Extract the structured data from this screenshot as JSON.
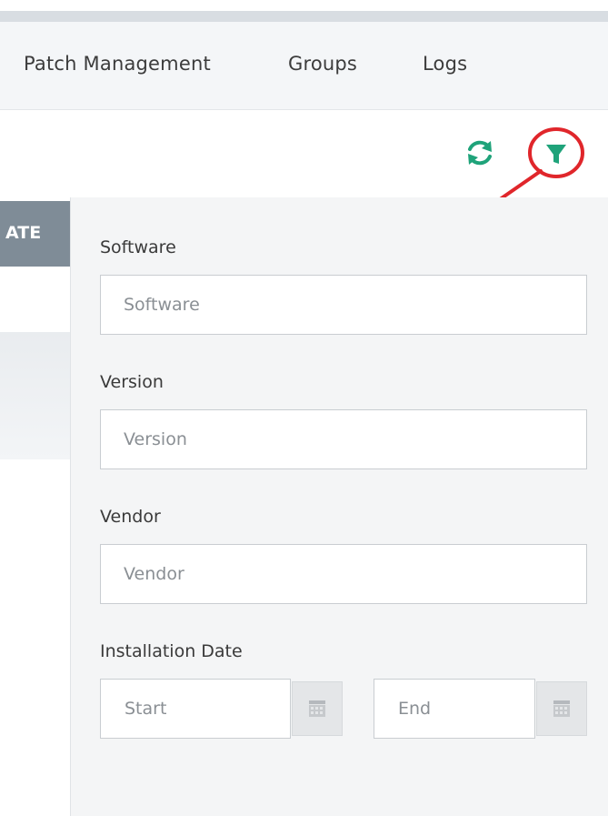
{
  "nav": {
    "items": [
      {
        "label": "Patch Management"
      },
      {
        "label": "Groups"
      },
      {
        "label": "Logs"
      }
    ]
  },
  "toolbar": {
    "refresh_icon": "refresh-icon",
    "filter_icon": "filter-icon",
    "accent_color": "#1fa37a",
    "annotation_color": "#e0262b"
  },
  "left_column": {
    "header_text": "ATE"
  },
  "filter": {
    "software": {
      "label": "Software",
      "placeholder": "Software",
      "value": ""
    },
    "version": {
      "label": "Version",
      "placeholder": "Version",
      "value": ""
    },
    "vendor": {
      "label": "Vendor",
      "placeholder": "Vendor",
      "value": ""
    },
    "installation_date": {
      "label": "Installation Date",
      "start_placeholder": "Start",
      "end_placeholder": "End",
      "calendar_icon": "calendar-icon"
    }
  }
}
